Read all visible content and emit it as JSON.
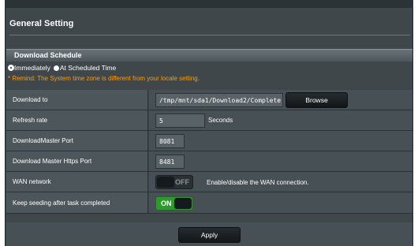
{
  "page": {
    "title": "General Setting"
  },
  "schedule": {
    "section_title": "Download Schedule",
    "option_immediately": "Immediately",
    "option_scheduled": "At Scheduled Time",
    "remind": "* Remind: The System time zone is different from your locale setting."
  },
  "settings": {
    "download_to": {
      "label": "Download to",
      "value": "/tmp/mnt/sda1/Download2/Complete",
      "button": "Browse"
    },
    "refresh_rate": {
      "label": "Refresh rate",
      "value": "5",
      "unit": "Seconds"
    },
    "dm_port": {
      "label": "DownloadMaster Port",
      "value": "8081"
    },
    "https_port": {
      "label": "Download Master Https Port",
      "value": "8481"
    },
    "wan_network": {
      "label": "WAN network",
      "toggle": "OFF",
      "description": "Enable/disable the WAN connection."
    },
    "keep_seeding": {
      "label": "Keep seeding after task completed",
      "toggle": "ON"
    }
  },
  "footer": {
    "apply": "Apply"
  },
  "colors": {
    "panel": "#3f474b",
    "accent_on": "#2d9a2d",
    "remind": "#ff9c00"
  },
  "icons": {
    "radio_selected": "radio-checked-icon",
    "radio_unselected": "radio-unchecked-icon"
  }
}
